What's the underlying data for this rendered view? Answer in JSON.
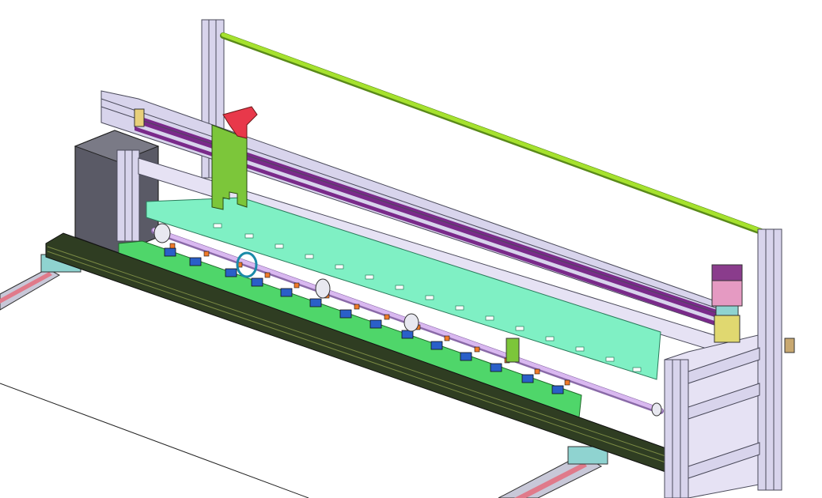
{
  "scene": {
    "description_visible_text": "",
    "colors": {
      "background": "#ffffff",
      "frame_aluminum": "#d8d4ec",
      "frame_edge": "#4a4a5a",
      "top_rod": "#a6e22e",
      "feed_table": "#7ff0c4",
      "green_rail": "#4fd66a",
      "dark_rail": "#2f3d22",
      "purple_strip": "#7a2a8a",
      "red_bracket": "#e8384a",
      "green_plate": "#7cc63a",
      "motor_pink": "#e59ac2",
      "motor_purple": "#8a3c8c",
      "shaft_lilac": "#d9b8f0",
      "blue_clamp": "#2a5fc8",
      "orange_tip": "#f07a2a",
      "pink_track": "#e07a8a",
      "enclosure_gray": "#5a5a66"
    },
    "components": [
      "aluminum-frame-icon",
      "top-guide-rod-icon",
      "cutter-carriage-icon",
      "feed-table-icon",
      "clamp-row-icon",
      "stepper-motor-icon",
      "control-box-icon",
      "drive-shaft-icon"
    ]
  }
}
